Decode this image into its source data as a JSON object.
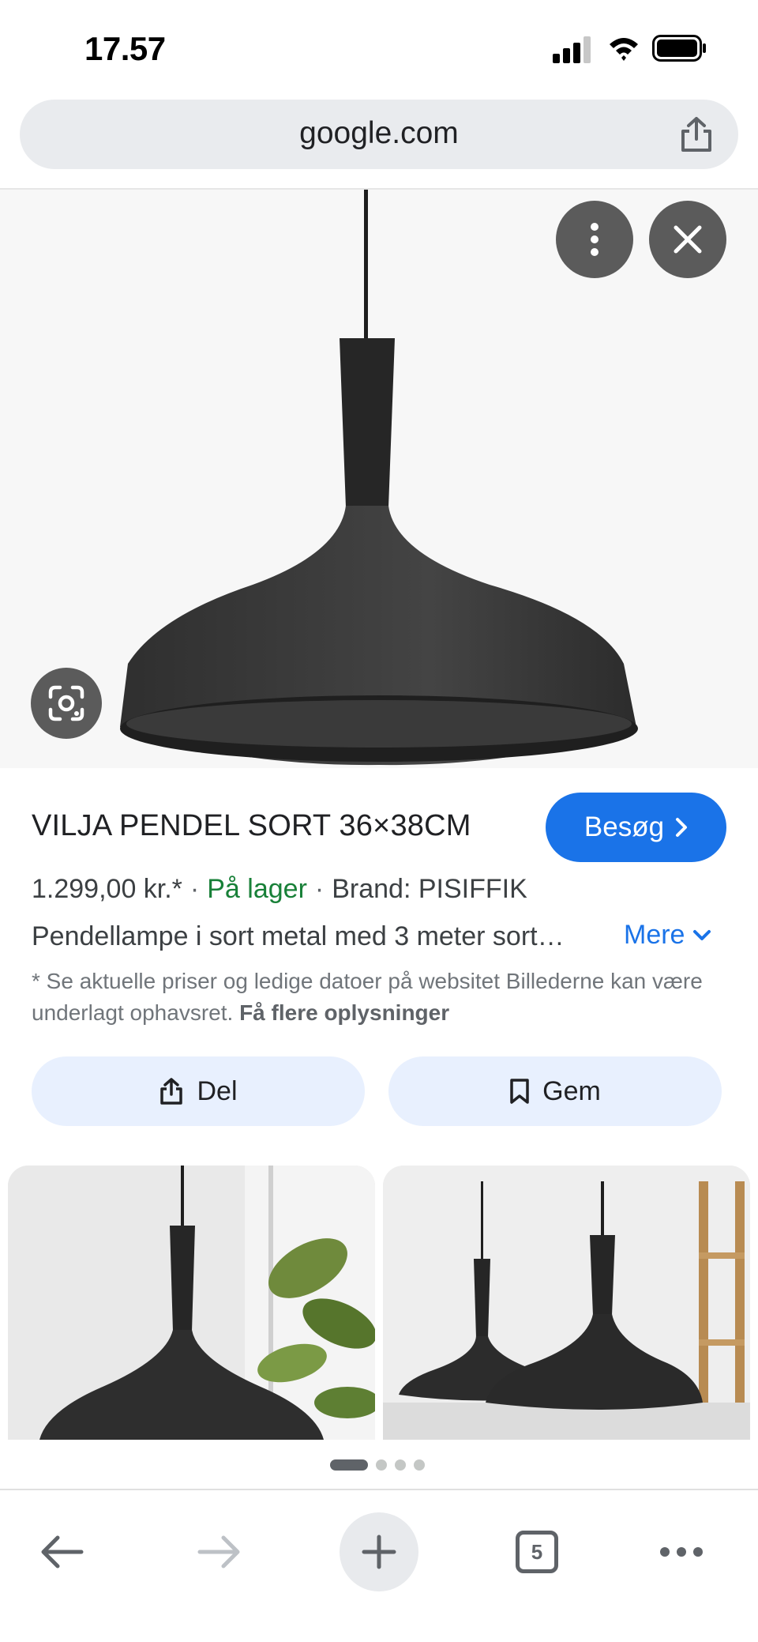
{
  "status_bar": {
    "time": "17.57"
  },
  "browser": {
    "url": "google.com",
    "open_tabs": "5"
  },
  "product": {
    "title": "VILJA PENDEL SORT 36×38CM",
    "visit_label": "Besøg",
    "price": "1.299,00 kr.*",
    "separator": "·",
    "stock": "På lager",
    "brand": "Brand: PISIFFIK",
    "description": "Pendellampe i sort metal med 3 meter sort…",
    "more_label": "Mere",
    "disclaimer": "* Se aktuelle priser og ledige datoer på websitet Billederne kan være underlagt ophavsret.",
    "disclaimer_link": "Få flere oplysninger",
    "share_label": "Del",
    "save_label": "Gem"
  },
  "colors": {
    "accent": "#1a73e8",
    "stock": "#188038",
    "chip_bg": "#e8f0fe"
  }
}
